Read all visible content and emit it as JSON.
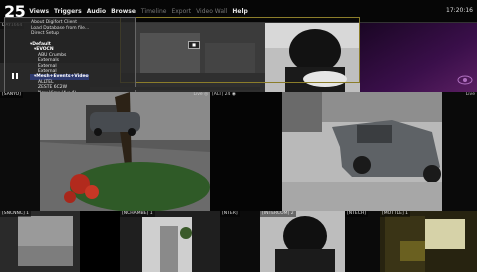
{
  "app": {
    "logo": "25"
  },
  "menubar": {
    "items": [
      "Views",
      "Triggers",
      "Audio",
      "Browse"
    ],
    "dim_items": [
      "Timeline",
      "Export",
      "Video Wall"
    ],
    "last_item": "Help",
    "clock": "17:20:16"
  },
  "overlay_menu": {
    "header_label": "Default",
    "items": [
      "About Digifort Client",
      "Load Database from file...",
      "Direct Setup"
    ],
    "tree": [
      {
        "label": "Default",
        "level": 0,
        "bold": true
      },
      {
        "label": "EVOCN",
        "level": 1,
        "bold": true
      },
      {
        "label": "ABU Crumbs",
        "level": 2
      },
      {
        "label": "Externals",
        "level": 2
      },
      {
        "label": "External",
        "level": 2
      },
      {
        "label": "External",
        "level": 2
      },
      {
        "label": "Mesh+Events+Video",
        "level": 1,
        "bold": true,
        "selected": true
      },
      {
        "label": "ALLTEL",
        "level": 2
      },
      {
        "label": "ZESTE 6C2W",
        "level": 2
      },
      {
        "label": "New View (4 x 4)",
        "level": 2
      },
      {
        "label": "New View (3 x 3)",
        "level": 2
      },
      {
        "label": "Carousel",
        "level": 2
      },
      {
        "label": "Tools",
        "level": 1,
        "bold": true
      },
      {
        "label": "Dialerz Maps",
        "level": 1,
        "bold": true
      }
    ],
    "stop_label": "■"
  },
  "cameras": {
    "top_left_label": "DAY1664",
    "main_left_label": "[SANYO]",
    "main_left_live": "Live ◎",
    "main_mid_label": "[ALT] 24",
    "main_mid_live": "[ALT] 24 ◉",
    "main_right_live": "Live",
    "bottom_labels": [
      "[SNCNNC] 1",
      "[NCHAMBE] 1",
      "[NTER]",
      "[INTERCOM] 2",
      "[NTECH]",
      "[MOTTLE] 1"
    ],
    "bottom_live": "Live ◎"
  },
  "colors": {
    "accent": "#8b7d2a",
    "selection": "#2e3a6e",
    "menubar_bg": "#060606"
  },
  "icons": [
    "pause-icon",
    "eye-icon",
    "stop-icon"
  ]
}
